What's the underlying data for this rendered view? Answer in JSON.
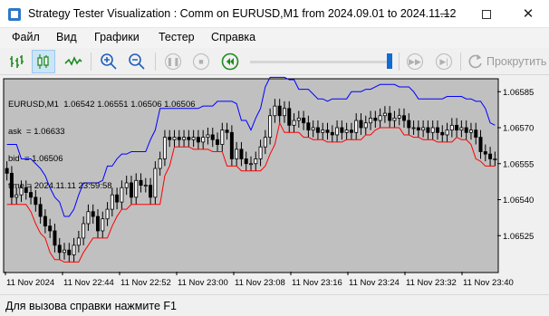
{
  "window": {
    "title": "Strategy Tester Visualization : Comm on EURUSD,M1 from 2024.09.01 to 2024.11.12"
  },
  "menu": [
    "Файл",
    "Вид",
    "Графики",
    "Тестер",
    "Справка"
  ],
  "toolbar": {
    "buttons": [
      "bar-chart-icon",
      "candlestick-icon",
      "line-chart-icon",
      "zoom-in-icon",
      "zoom-out-icon",
      "pause-icon",
      "stop-icon",
      "rewind-icon",
      "fast-forward-icon",
      "step-icon"
    ],
    "speed_level": 0.97,
    "scroll_label": "Прокрутить"
  },
  "chart": {
    "symbol_line": "EURUSD,M1  1.06542 1.06551 1.06506 1.06506",
    "ask_line": "ask  = 1.06633",
    "bid_line": "bid  = 1.06506",
    "time_line": "time = 2024.11.11 23:59:58",
    "colors": {
      "background": "#c0c0c0",
      "candle_up": "#ffffff",
      "candle_down": "#000000",
      "upper_band": "#0000ff",
      "lower_band": "#ff0000"
    },
    "chart_data": {
      "type": "line",
      "title": "",
      "xlabel": "",
      "ylabel": "",
      "ylim": [
        1.0651,
        1.0659
      ],
      "x": [
        "11 Nov 2024",
        "11 Nov 22:44",
        "11 Nov 22:52",
        "11 Nov 23:00",
        "11 Nov 23:08",
        "11 Nov 23:16",
        "11 Nov 23:24",
        "11 Nov 23:32",
        "11 Nov 23:40"
      ],
      "y_ticks": [
        "1.06585",
        "1.06570",
        "1.06555",
        "1.06540",
        "1.06525"
      ],
      "series": [
        {
          "values": [
            1.06551,
            1.06541,
            1.06542,
            1.06545,
            1.06543,
            1.06541,
            1.06538,
            1.06533,
            1.06529,
            1.06527,
            1.06521,
            1.06518,
            1.06519,
            1.06517,
            1.06521,
            1.06524,
            1.0653,
            1.06535,
            1.06533,
            1.06527,
            1.06532,
            1.06536,
            1.06542,
            1.06539,
            1.06545,
            1.06547,
            1.06541,
            1.06548,
            1.06546,
            1.06546,
            1.06541,
            1.06553,
            1.06557,
            1.06566,
            1.06565,
            1.06566,
            1.06565,
            1.06566,
            1.06565,
            1.06566,
            1.06564,
            1.06566,
            1.06567,
            1.06565,
            1.06563,
            1.06569,
            1.06568,
            1.06557,
            1.06561,
            1.06557,
            1.06555,
            1.06555,
            1.06557,
            1.06562,
            1.06566,
            1.06575,
            1.06579,
            1.06575,
            1.06578,
            1.06571,
            1.06573,
            1.06574,
            1.06572,
            1.06569,
            1.0657,
            1.06568,
            1.06569,
            1.06568,
            1.06567,
            1.0657,
            1.06568,
            1.06569,
            1.06568,
            1.06573,
            1.0657,
            1.06572,
            1.06574,
            1.06573,
            1.06575,
            1.06576,
            1.06573,
            1.06574,
            1.06575,
            1.06573,
            1.0657,
            1.0657,
            1.06569,
            1.0657,
            1.06568,
            1.0657,
            1.06568,
            1.06567,
            1.06569,
            1.06571,
            1.06569,
            1.0657,
            1.06568,
            1.06569,
            1.06566,
            1.0656,
            1.06559,
            1.06557,
            1.06557
          ]
        }
      ]
    }
  },
  "status": {
    "text": "Для вызова справки нажмите F1"
  }
}
